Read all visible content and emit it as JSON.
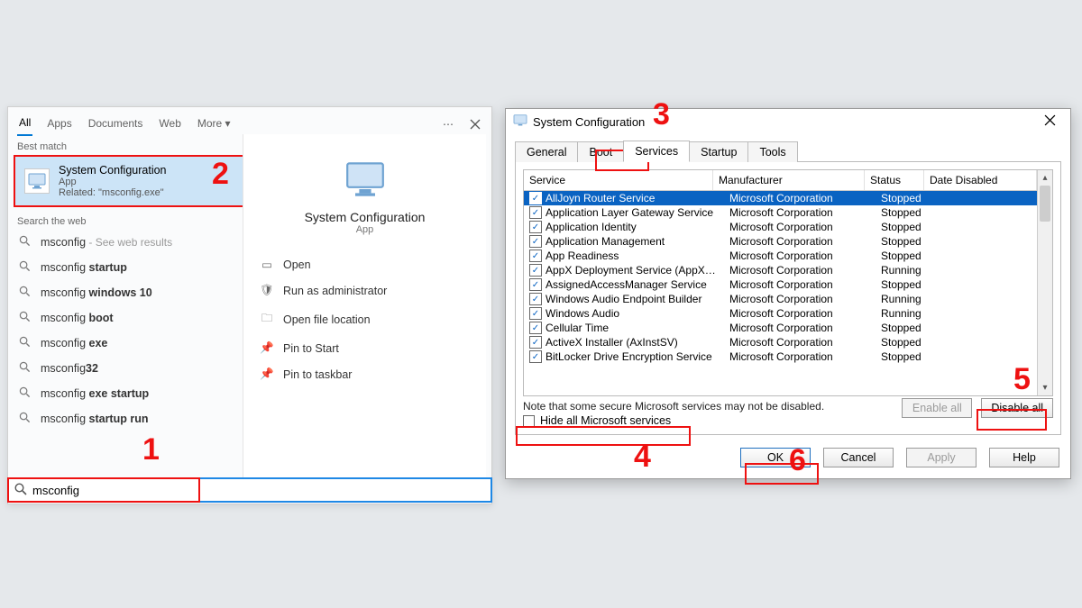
{
  "search_panel": {
    "tabs": [
      "All",
      "Apps",
      "Documents",
      "Web",
      "More ▾"
    ],
    "best_match_label": "Best match",
    "best_match": {
      "title": "System Configuration",
      "kind": "App",
      "related": "Related: \"msconfig.exe\""
    },
    "web_label": "Search the web",
    "web_items": [
      {
        "pre": "msconfig",
        "bold": "",
        "hint": " - See web results"
      },
      {
        "pre": "msconfig ",
        "bold": "startup",
        "hint": ""
      },
      {
        "pre": "msconfig ",
        "bold": "windows 10",
        "hint": ""
      },
      {
        "pre": "msconfig ",
        "bold": "boot",
        "hint": ""
      },
      {
        "pre": "msconfig ",
        "bold": "exe",
        "hint": ""
      },
      {
        "pre": "msconfig",
        "bold": "32",
        "hint": ""
      },
      {
        "pre": "msconfig ",
        "bold": "exe startup",
        "hint": ""
      },
      {
        "pre": "msconfig ",
        "bold": "startup run",
        "hint": ""
      }
    ],
    "preview": {
      "title": "System Configuration",
      "sub": "App",
      "actions": [
        "Open",
        "Run as administrator",
        "Open file location",
        "Pin to Start",
        "Pin to taskbar"
      ]
    }
  },
  "search_box": {
    "value": "msconfig"
  },
  "dialog": {
    "title": "System Configuration",
    "tabs": [
      "General",
      "Boot",
      "Services",
      "Startup",
      "Tools"
    ],
    "active_tab": "Services",
    "columns": [
      "Service",
      "Manufacturer",
      "Status",
      "Date Disabled"
    ],
    "rows": [
      {
        "svc": "AllJoyn Router Service",
        "mfg": "Microsoft Corporation",
        "st": "Stopped",
        "sel": true
      },
      {
        "svc": "Application Layer Gateway Service",
        "mfg": "Microsoft Corporation",
        "st": "Stopped"
      },
      {
        "svc": "Application Identity",
        "mfg": "Microsoft Corporation",
        "st": "Stopped"
      },
      {
        "svc": "Application Management",
        "mfg": "Microsoft Corporation",
        "st": "Stopped"
      },
      {
        "svc": "App Readiness",
        "mfg": "Microsoft Corporation",
        "st": "Stopped"
      },
      {
        "svc": "AppX Deployment Service (AppX…",
        "mfg": "Microsoft Corporation",
        "st": "Running"
      },
      {
        "svc": "AssignedAccessManager Service",
        "mfg": "Microsoft Corporation",
        "st": "Stopped"
      },
      {
        "svc": "Windows Audio Endpoint Builder",
        "mfg": "Microsoft Corporation",
        "st": "Running"
      },
      {
        "svc": "Windows Audio",
        "mfg": "Microsoft Corporation",
        "st": "Running"
      },
      {
        "svc": "Cellular Time",
        "mfg": "Microsoft Corporation",
        "st": "Stopped"
      },
      {
        "svc": "ActiveX Installer (AxInstSV)",
        "mfg": "Microsoft Corporation",
        "st": "Stopped"
      },
      {
        "svc": "BitLocker Drive Encryption Service",
        "mfg": "Microsoft Corporation",
        "st": "Stopped"
      }
    ],
    "note": "Note that some secure Microsoft services may not be disabled.",
    "hide_label": "Hide all Microsoft services",
    "enable_all": "Enable all",
    "disable_all": "Disable all",
    "buttons": {
      "ok": "OK",
      "cancel": "Cancel",
      "apply": "Apply",
      "help": "Help"
    }
  },
  "callouts": {
    "1": "1",
    "2": "2",
    "3": "3",
    "4": "4",
    "5": "5",
    "6": "6"
  }
}
